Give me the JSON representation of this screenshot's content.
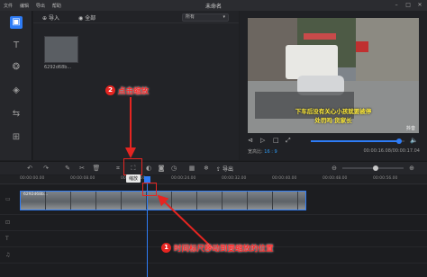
{
  "window": {
    "title": "未命名",
    "menu": [
      "文件",
      "编辑",
      "导出",
      "帮助"
    ],
    "controls": [
      "minimize-icon",
      "maximize-icon",
      "close-icon"
    ]
  },
  "rail": {
    "items": [
      "media-icon",
      "text-icon",
      "filter-icon",
      "overlay-icon",
      "transition-icon",
      "element-icon"
    ]
  },
  "media": {
    "import_label": "导入",
    "select_all_label": "全部",
    "sort_value": "所有",
    "clip_name": "6292d68b..."
  },
  "player": {
    "subtitle_line1": "下车后没有关心小孩就要被停",
    "subtitle_line2": "处罚吗 货家长",
    "watermark": "抖音",
    "aspect_label": "宽高比:",
    "aspect_value": "16 : 9",
    "current_time": "00:00:16.08",
    "total_time": "00:00:17.04",
    "progress": 0.94
  },
  "toolbar": {
    "zoom_tooltip": "缩放",
    "export_label": "导出",
    "zoom_level": 0.55
  },
  "ruler": {
    "ticks": [
      "00:00:00.00",
      "00:00:08.00",
      "00:00:16.00",
      "00:00:24.00",
      "00:00:32.00",
      "00:00:40.00",
      "00:00:48.00",
      "00:00:56.00"
    ]
  },
  "timeline": {
    "clip_label": "6292d68b..."
  },
  "annotations": {
    "step1_number": "1",
    "step1_text": "时间标尺移动到要缩放的位置",
    "step2_number": "2",
    "step2_text": "点击缩放"
  },
  "colors": {
    "accent": "#2e7cf6",
    "annotation": "#e52521"
  }
}
